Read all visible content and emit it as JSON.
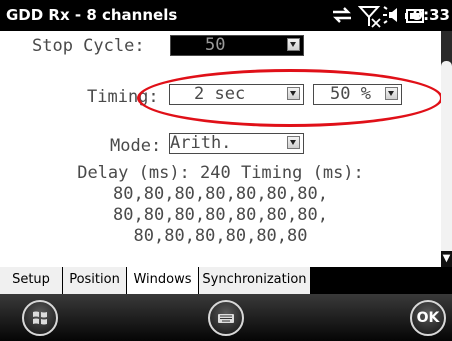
{
  "status_bar": {
    "title": "GDD Rx - 8 channels",
    "clock": "9:33",
    "icons": [
      "connectivity-icon",
      "signal-off-icon",
      "volume-icon",
      "battery-icon"
    ]
  },
  "form": {
    "stop_cycle_label": "Stop Cycle:",
    "stop_cycle_value": "50",
    "timing_label": "Timing:",
    "timing_value": "2 sec",
    "timing_percent_value": "50 %",
    "mode_label": "Mode:",
    "mode_value": "Arith."
  },
  "delay_info": {
    "line1": "Delay (ms): 240 Timing (ms):",
    "line2": "80,80,80,80,80,80,80,",
    "line3": "80,80,80,80,80,80,80,",
    "line4": "80,80,80,80,80,80"
  },
  "tabs": [
    {
      "label": "Setup",
      "active": false
    },
    {
      "label": "Position",
      "active": false
    },
    {
      "label": "Windows",
      "active": true
    },
    {
      "label": "Synchronization",
      "active": false
    }
  ],
  "softkeys": {
    "ok_label": "OK",
    "start_icon": "windows-start-icon",
    "keyboard_icon": "keyboard-icon"
  },
  "colors": {
    "highlight": "#e01018",
    "status_bar": "#000000"
  }
}
